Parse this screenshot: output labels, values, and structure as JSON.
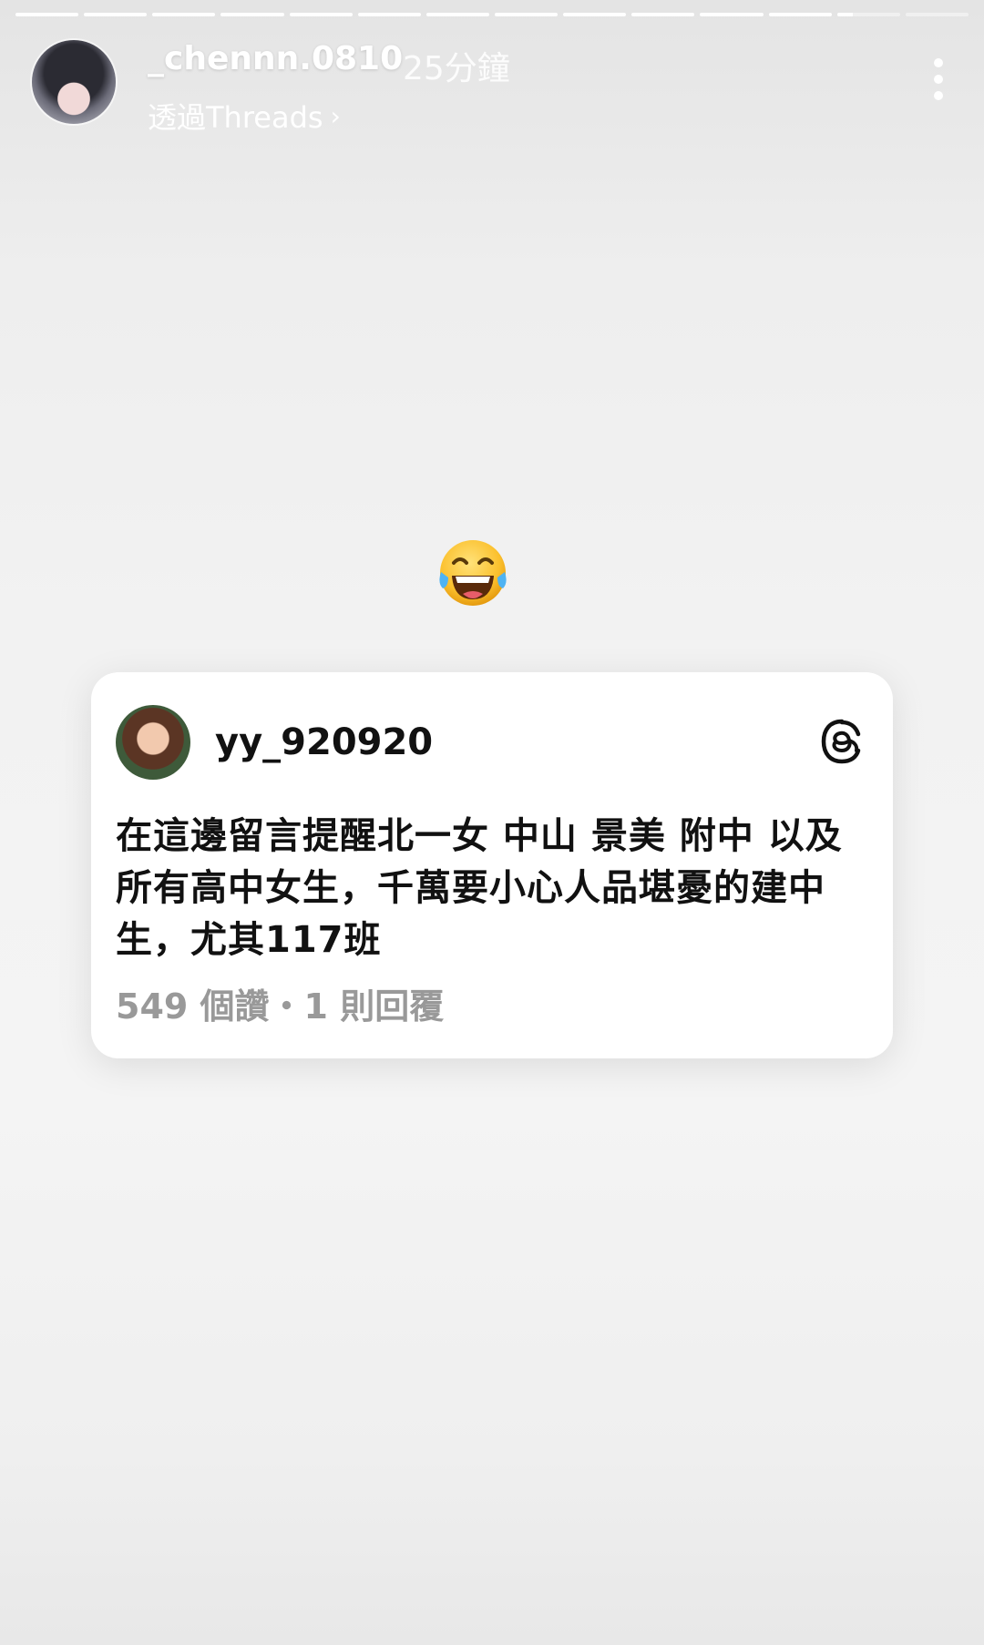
{
  "story": {
    "segments_total": 14,
    "segments_complete": 12,
    "current_segment_progress": 0.25
  },
  "header": {
    "username": "_chennn.0810",
    "time": "25分鐘",
    "via": "透過Threads",
    "chevron": "›",
    "avatar_icon": "profile-avatar",
    "more_icon": "more-vertical-icon"
  },
  "sticker": {
    "emoji": "face-with-tears-of-joy"
  },
  "card": {
    "username": "yy_920920",
    "text": "在這邊留言提醒北一女 中山 景美 附中 以及所有高中女生，千萬要小心人品堪憂的建中生，尤其117班",
    "stats": "549 個讚・1 則回覆",
    "brand_icon": "threads-icon"
  },
  "colors": {
    "header_text": "#ffffff",
    "card_bg": "#ffffff",
    "card_text": "#111111",
    "meta_text": "#999999"
  }
}
